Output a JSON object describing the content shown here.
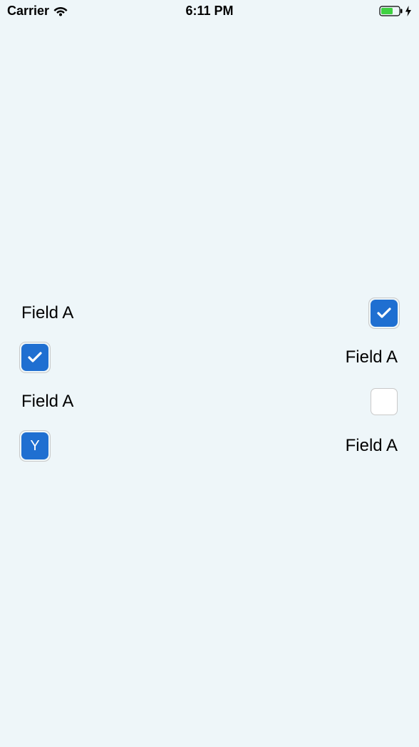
{
  "statusBar": {
    "carrier": "Carrier",
    "time": "6:11 PM"
  },
  "rows": [
    {
      "label": "Field A",
      "labelSide": "left",
      "checked": true,
      "checkType": "check"
    },
    {
      "label": "Field A",
      "labelSide": "right",
      "checked": true,
      "checkType": "check"
    },
    {
      "label": "Field A",
      "labelSide": "left",
      "checked": false,
      "checkType": "none"
    },
    {
      "label": "Field A",
      "labelSide": "right",
      "checked": true,
      "checkType": "text",
      "checkText": "Y"
    }
  ]
}
